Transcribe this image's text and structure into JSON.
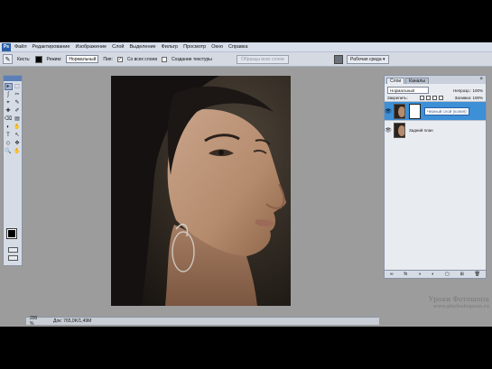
{
  "menubar": {
    "app_badge": "Ps",
    "items": [
      "Файл",
      "Редактирование",
      "Изображение",
      "Слой",
      "Выделение",
      "Фильтр",
      "Просмотр",
      "Окно",
      "Справка"
    ]
  },
  "options": {
    "brush_label": "Кисть:",
    "mode_label": "Режим:",
    "mode_value": "Нормальный",
    "sample_label": "Пип:",
    "sample_all_label": "Со всех слоев",
    "sample_all_checked": true,
    "create_texture_label": "Создание текстуры",
    "hide_button": "Образцы всех слоев",
    "workspace_label": "Рабочая среда ▾"
  },
  "tools": [
    "▸",
    "⬚",
    "ʃ",
    "✂",
    "⌖",
    "✎",
    "✚",
    "✐",
    "⌫",
    "▤",
    "◐",
    "✋",
    "T",
    "↖",
    "◇",
    "✥",
    "🔍",
    "✋"
  ],
  "status": {
    "zoom": "200 %",
    "doc": "Док: 765,0K/1,49M"
  },
  "layers": {
    "tabs": [
      "Слои",
      "Каналы"
    ],
    "close_glyph": "×",
    "blend_mode": "Нормальный",
    "opacity_label": "Непрозр.: 100%",
    "lock_label": "Закрепить:",
    "fill_label": "Заливка: 100%",
    "items": [
      {
        "name": "Черный слой (копия)",
        "visible": true,
        "selected": true,
        "has_mask": true
      },
      {
        "name": "Задний план",
        "visible": true,
        "selected": false,
        "has_mask": false
      }
    ],
    "footer_icons": [
      "∞",
      "fx",
      "◑",
      "◐",
      "▢",
      "⊞",
      "🗑"
    ]
  },
  "watermark": {
    "name": "Уроки Фотошопа",
    "site": "www.photoshopsun.ru"
  },
  "colors": {
    "menubar_bg": "#d8dfeb",
    "canvas_bg": "#9c9c9c",
    "selection": "#3d8fd6"
  }
}
